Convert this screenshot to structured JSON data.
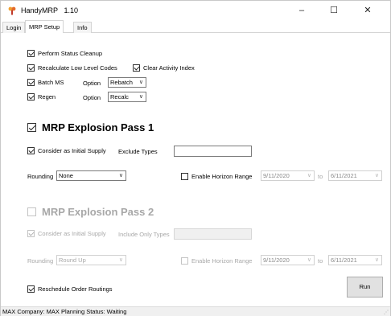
{
  "window": {
    "title": "HandyMRP",
    "version": "1.10",
    "controls": {
      "minimize": "–",
      "maximize": "☐",
      "close": "✕"
    }
  },
  "tabs": [
    {
      "label": "Login"
    },
    {
      "label": "MRP Setup"
    },
    {
      "label": "Info"
    }
  ],
  "setup": {
    "perform_status_cleanup": {
      "label": "Perform Status Cleanup",
      "checked": true
    },
    "recalc_low_level_codes": {
      "label": "Recalculate Low Level Codes",
      "checked": true
    },
    "clear_activity_index": {
      "label": "Clear Activity Index",
      "checked": true
    },
    "batch_ms": {
      "label": "Batch MS",
      "checked": true,
      "option_label": "Option",
      "option_value": "Rebatch"
    },
    "regen": {
      "label": "Regen",
      "checked": true,
      "option_label": "Option",
      "option_value": "Recalc"
    }
  },
  "pass1": {
    "title": "MRP Explosion Pass 1",
    "checked": true,
    "consider_initial_supply": {
      "label": "Consider as Initial Supply",
      "checked": true
    },
    "exclude_types_label": "Exclude Types",
    "exclude_types_value": "",
    "rounding_label": "Rounding",
    "rounding_value": "None",
    "horizon": {
      "label": "Enable Horizon Range",
      "checked": false,
      "from": "9/11/2020",
      "to_label": "to",
      "to": "6/11/2021"
    }
  },
  "pass2": {
    "title": "MRP Explosion Pass 2",
    "checked": false,
    "consider_initial_supply": {
      "label": "Consider as Initial Supply",
      "checked": true
    },
    "include_types_label": "Include Only Types",
    "include_types_value": "",
    "rounding_label": "Rounding",
    "rounding_value": "Round Up",
    "horizon": {
      "label": "Enable Horizon Range",
      "checked": false,
      "from": "9/11/2020",
      "to_label": "to",
      "to": "6/11/2021"
    }
  },
  "reschedule_order_routings": {
    "label": "Reschedule Order Routings",
    "checked": true
  },
  "run_label": "Run",
  "status": "MAX Company: MAX Planning  Status: Waiting",
  "colors": {
    "icon_accent": "#f0a030",
    "disabled_text": "#a8a8a8"
  }
}
